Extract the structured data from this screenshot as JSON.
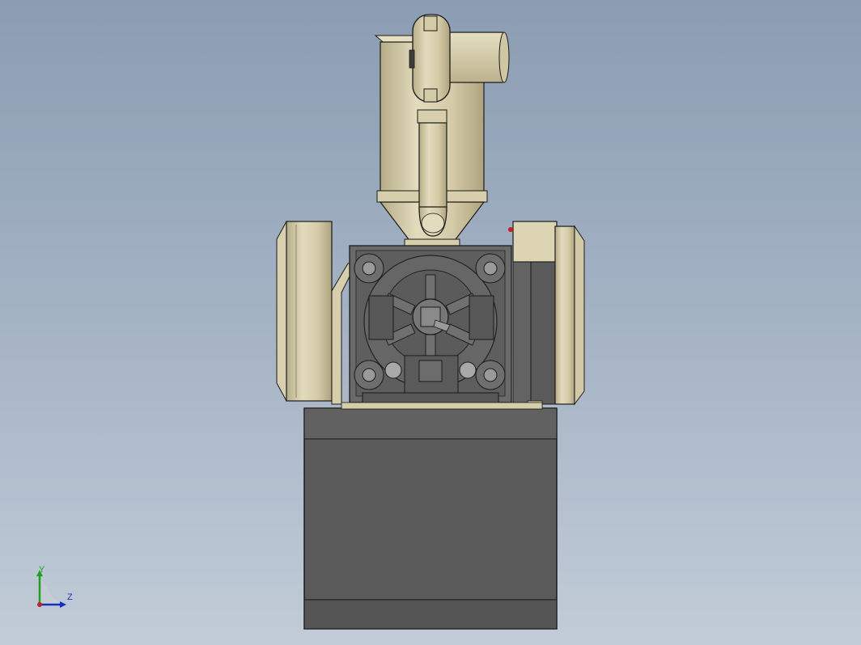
{
  "viewport": {
    "background_top": "#8b9db2",
    "background_bottom": "#c2ccd8"
  },
  "triad": {
    "y_label": "Y",
    "z_label": "Z",
    "y_color": "#20a020",
    "z_color": "#1530c0",
    "x_color": "#c02020"
  },
  "colors": {
    "tan_part": "#d8cfae",
    "tan_shadow": "#b9ae89",
    "dark_metal": "#5e5e5e",
    "base_body": "#5a5a5a",
    "outline": "#1a1a1a"
  }
}
